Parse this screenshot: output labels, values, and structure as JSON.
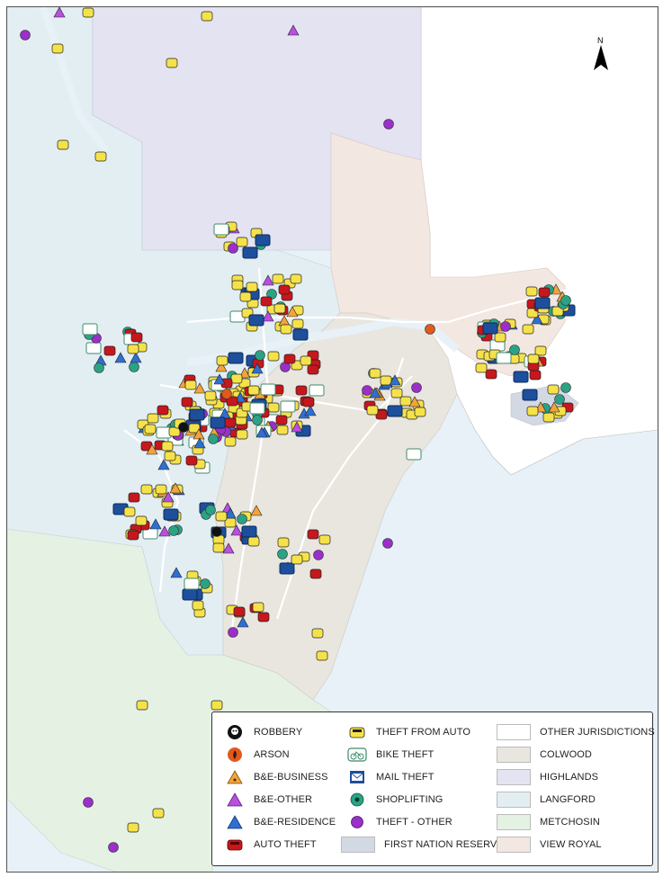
{
  "north_label": "N",
  "colors": {
    "water": "#e7f1f7",
    "other_jurisdictions": "#ffffff",
    "colwood": "#e9e6df",
    "highlands": "#e3e3f1",
    "langford": "#e3eef3",
    "metchosin": "#e4f1e3",
    "view_royal": "#f3e7e1",
    "first_nation_reserves": "#d3d9e3"
  },
  "legend": {
    "items": [
      {
        "label": "ROBBERY",
        "icon": "robbery-icon"
      },
      {
        "label": "ARSON",
        "icon": "arson-icon"
      },
      {
        "label": "B&E-BUSINESS",
        "icon": "be-business-icon"
      },
      {
        "label": "B&E-OTHER",
        "icon": "be-other-icon"
      },
      {
        "label": "B&E-RESIDENCE",
        "icon": "be-residence-icon"
      },
      {
        "label": "AUTO THEFT",
        "icon": "auto-theft-icon"
      },
      {
        "label": "THEFT FROM AUTO",
        "icon": "theft-from-auto-icon"
      },
      {
        "label": "BIKE THEFT",
        "icon": "bike-theft-icon"
      },
      {
        "label": "MAIL THEFT",
        "icon": "mail-theft-icon"
      },
      {
        "label": "SHOPLIFTING",
        "icon": "shoplifting-icon"
      },
      {
        "label": "THEFT - OTHER",
        "icon": "theft-other-icon"
      }
    ],
    "areas": [
      {
        "label": "FIRST NATION RESERVES",
        "color": "#d3d9e3"
      },
      {
        "label": "OTHER JURISDICTIONS",
        "color": "#ffffff"
      },
      {
        "label": "COLWOOD",
        "color": "#e9e6df"
      },
      {
        "label": "HIGHLANDS",
        "color": "#e3e3f1"
      },
      {
        "label": "LANGFORD",
        "color": "#e3eef3"
      },
      {
        "label": "METCHOSIN",
        "color": "#e4f1e3"
      },
      {
        "label": "VIEW ROYAL",
        "color": "#f3e7e1"
      }
    ]
  }
}
